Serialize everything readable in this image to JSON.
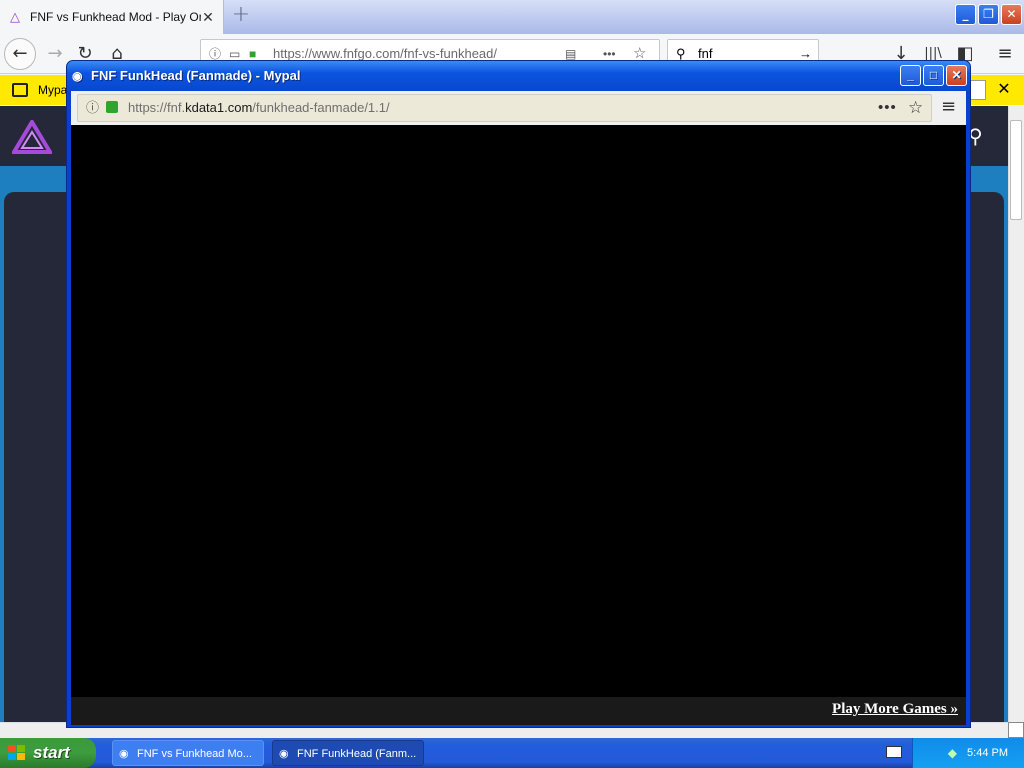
{
  "browser": {
    "tab": {
      "title": "FNF vs Funkhead Mod - Play Online",
      "close": "✕"
    },
    "new_tab": "+",
    "window_controls": {
      "minimize": "_",
      "restore": "❐",
      "close": "✕"
    },
    "nav": {
      "back": "←",
      "forward": "→",
      "reload": "↻",
      "home": "⌂",
      "url": "https://www.fnfgo.com/fnf-vs-funkhead/",
      "search_value": "fnf",
      "search_go": "→",
      "download": "↓",
      "library": "|||\\",
      "sidebar": "◧",
      "menu": "≡",
      "reader": "▤",
      "more": "•••",
      "bookmark": "☆"
    },
    "notification": {
      "text": "Mypal",
      "close": "✕"
    }
  },
  "site": {
    "search": "⚲"
  },
  "popup": {
    "title": "FNF FunkHead (Fanmade) - Mypal",
    "controls": {
      "minimize": "_",
      "maximize": "□",
      "close": "✕"
    },
    "url_prefix": "https://fnf.",
    "url_domain": "kdata1.com",
    "url_path": "/funkhead-fanmade/1.1/",
    "more": "•••",
    "bookmark": "☆",
    "menu": "≡",
    "footer_link": "Play More Games »"
  },
  "taskbar": {
    "start": "start",
    "tasks": [
      {
        "label": "FNF vs Funkhead Mo..."
      },
      {
        "label": "FNF FunkHead (Fanm..."
      }
    ],
    "clock": "5:44 PM"
  }
}
